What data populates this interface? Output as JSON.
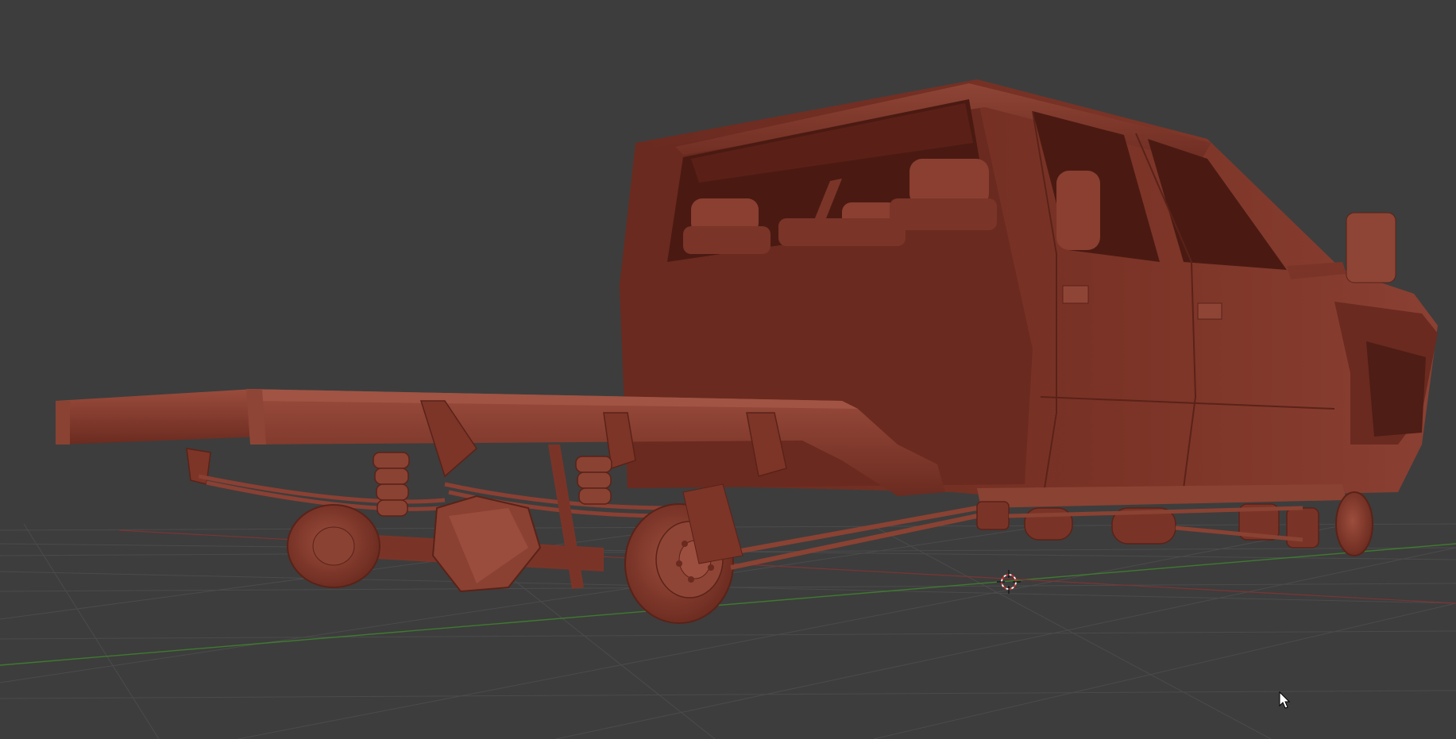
{
  "app": {
    "type": "3d-viewport"
  },
  "viewport": {
    "background": "#3d3d3d",
    "grid_color": "#4a4a4a",
    "axis_x_color": "#8a3a3a",
    "axis_y_color": "#3f7a2f",
    "model_color": "#7a3528",
    "model_shadow_color": "#5a2218",
    "model_highlight_color": "#9a4a3a"
  },
  "scene": {
    "object": "pickup-truck-chassis-cab-model",
    "shading": "solid-clay"
  },
  "icons": {
    "origin_cursor": "3d-cursor-icon",
    "mouse_pointer": "mouse-pointer-icon"
  }
}
